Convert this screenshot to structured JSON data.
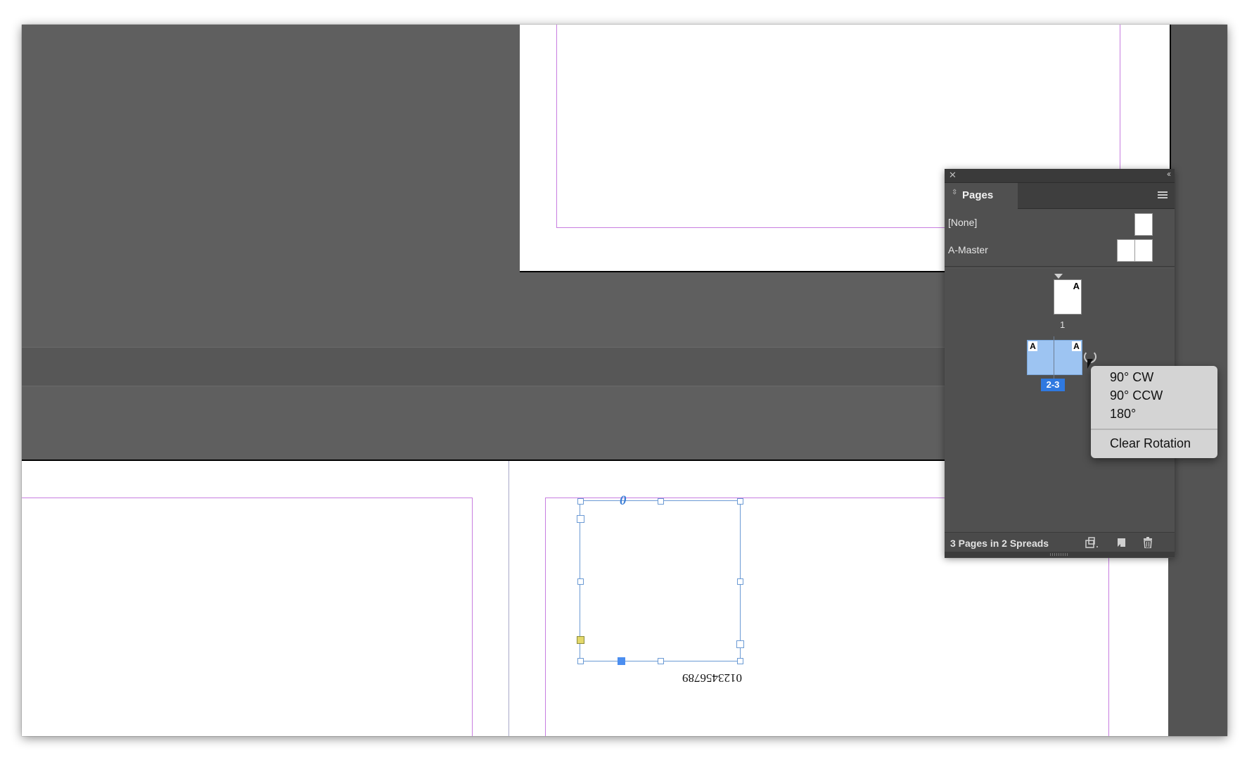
{
  "document": {
    "rotated_text": "0123456789",
    "object_origin_glyph": "0"
  },
  "pages_panel": {
    "close_glyph": "✕",
    "collapse_glyph": "‹‹",
    "tab_label": "Pages",
    "tab_arrows": "⇳",
    "masters": [
      {
        "label": "[None]"
      },
      {
        "label": "A-Master"
      }
    ],
    "page_thumbnails": [
      {
        "number_label": "1",
        "master_letter": "A"
      }
    ],
    "spread_thumbnail": {
      "label": "2-3",
      "left_letter": "A",
      "right_letter": "A",
      "selected": true,
      "selection_color": "#2f79e0"
    },
    "footer": {
      "status": "3 Pages in 2 Spreads",
      "buttons": [
        "edit-page-size-icon",
        "new-page-icon",
        "trash-icon"
      ]
    }
  },
  "rotation_menu": {
    "items": [
      "90° CW",
      "90° CCW",
      "180°"
    ],
    "clear_item": "Clear Rotation"
  },
  "colors": {
    "pasteboard": "#5f5f5f",
    "panel_bg": "#505050",
    "margin_guide": "#c77de0",
    "selection_frame": "#6b9ad4"
  }
}
